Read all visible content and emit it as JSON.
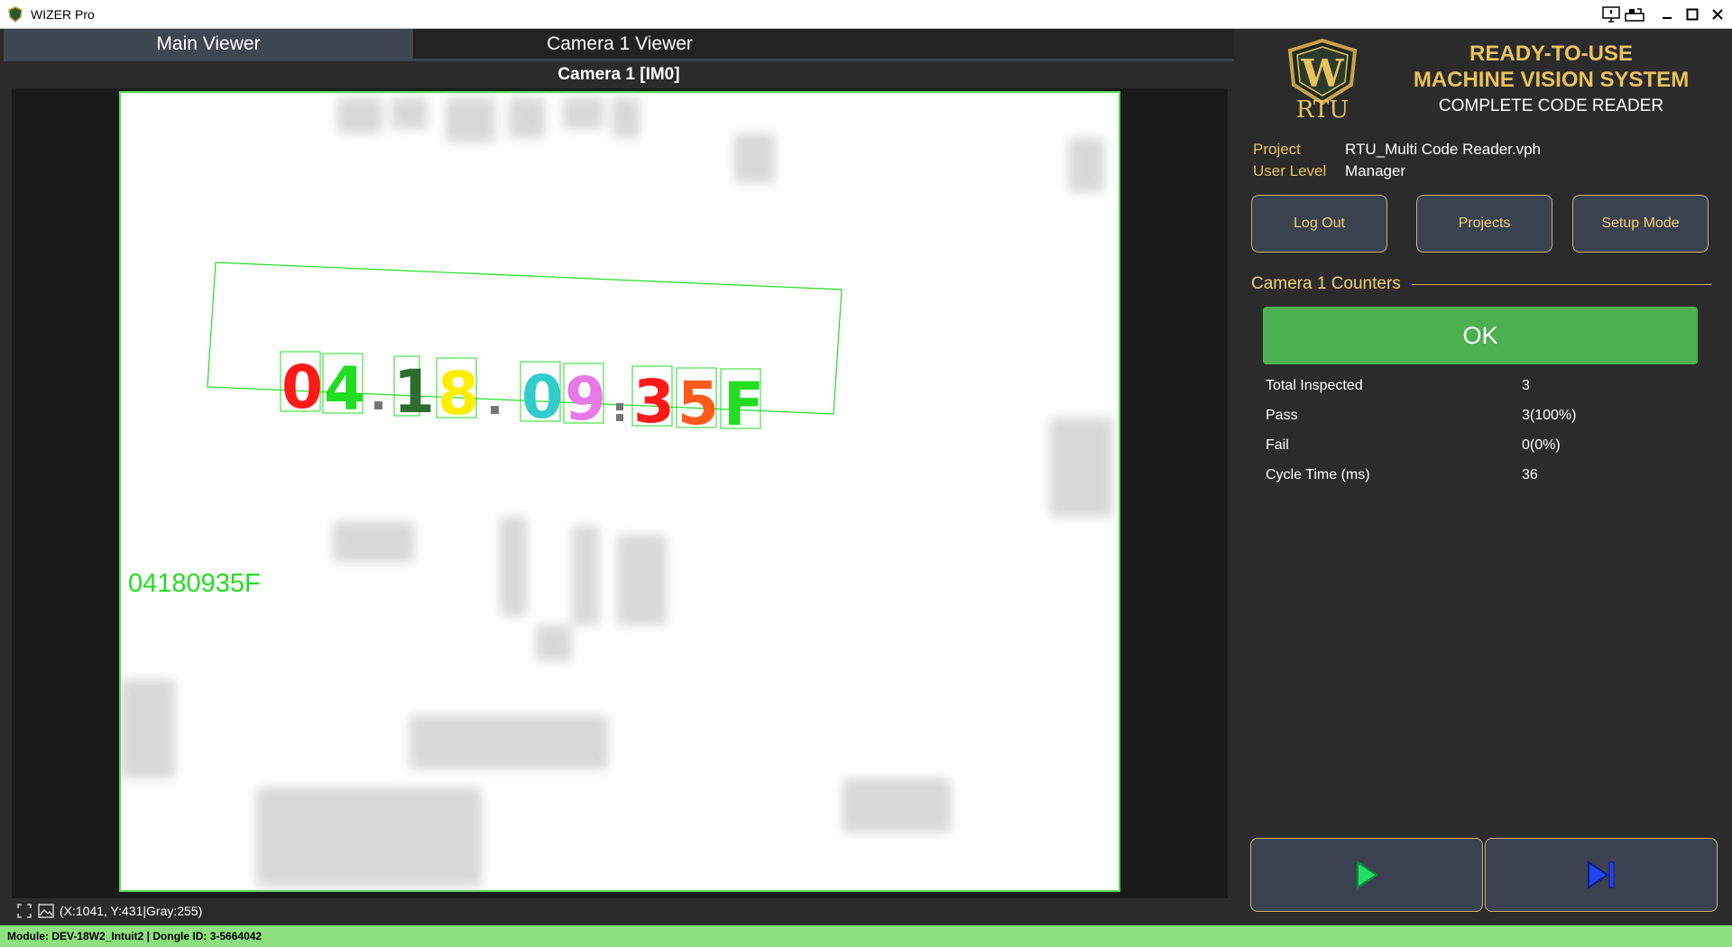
{
  "window": {
    "title": "WIZER Pro"
  },
  "tabs": [
    {
      "label": "Main Viewer",
      "active": true
    },
    {
      "label": "Camera 1 Viewer",
      "active": false
    }
  ],
  "viewer": {
    "caption": "Camera 1  [IM0]",
    "decoded_text": "04180935F",
    "characters": [
      {
        "char": "0",
        "color": "#ff1a1a"
      },
      {
        "char": "4",
        "color": "#22dd22"
      },
      {
        "char": "1",
        "color": "#2e6b2e"
      },
      {
        "char": "8",
        "color": "#ffee00"
      },
      {
        "char": "0",
        "color": "#33cccc"
      },
      {
        "char": "9",
        "color": "#e879e8"
      },
      {
        "char": "3",
        "color": "#ff1a1a"
      },
      {
        "char": "5",
        "color": "#ff5a1a"
      },
      {
        "char": "F",
        "color": "#22dd22"
      }
    ],
    "overlay_color": "#22dd22"
  },
  "coord_readout": "(X:1041, Y:431|Gray:255)",
  "status_bar": "Module: DEV-18W2_Intuit2 | Dongle ID: 3-5664042",
  "brand": {
    "line1": "READY-TO-USE",
    "line2": "MACHINE VISION SYSTEM",
    "subtitle": "COMPLETE CODE READER",
    "logo_text": "RTU",
    "logo_letter": "W"
  },
  "project": {
    "label": "Project",
    "value": "RTU_Multi Code Reader.vph"
  },
  "user_level": {
    "label": "User Level",
    "value": "Manager"
  },
  "buttons": {
    "logout": "Log Out",
    "projects": "Projects",
    "setup": "Setup Mode"
  },
  "counters": {
    "title": "Camera 1 Counters",
    "status": "OK",
    "rows": [
      {
        "label": "Total Inspected",
        "value": "3"
      },
      {
        "label": "Pass",
        "value": "3(100%)"
      },
      {
        "label": "Fail",
        "value": "0(0%)"
      },
      {
        "label": "Cycle Time (ms)",
        "value": "36"
      }
    ]
  },
  "colors": {
    "accent_gold": "#e8c25a",
    "ok_green": "#4caf50",
    "status_bar": "#8ee07f"
  }
}
